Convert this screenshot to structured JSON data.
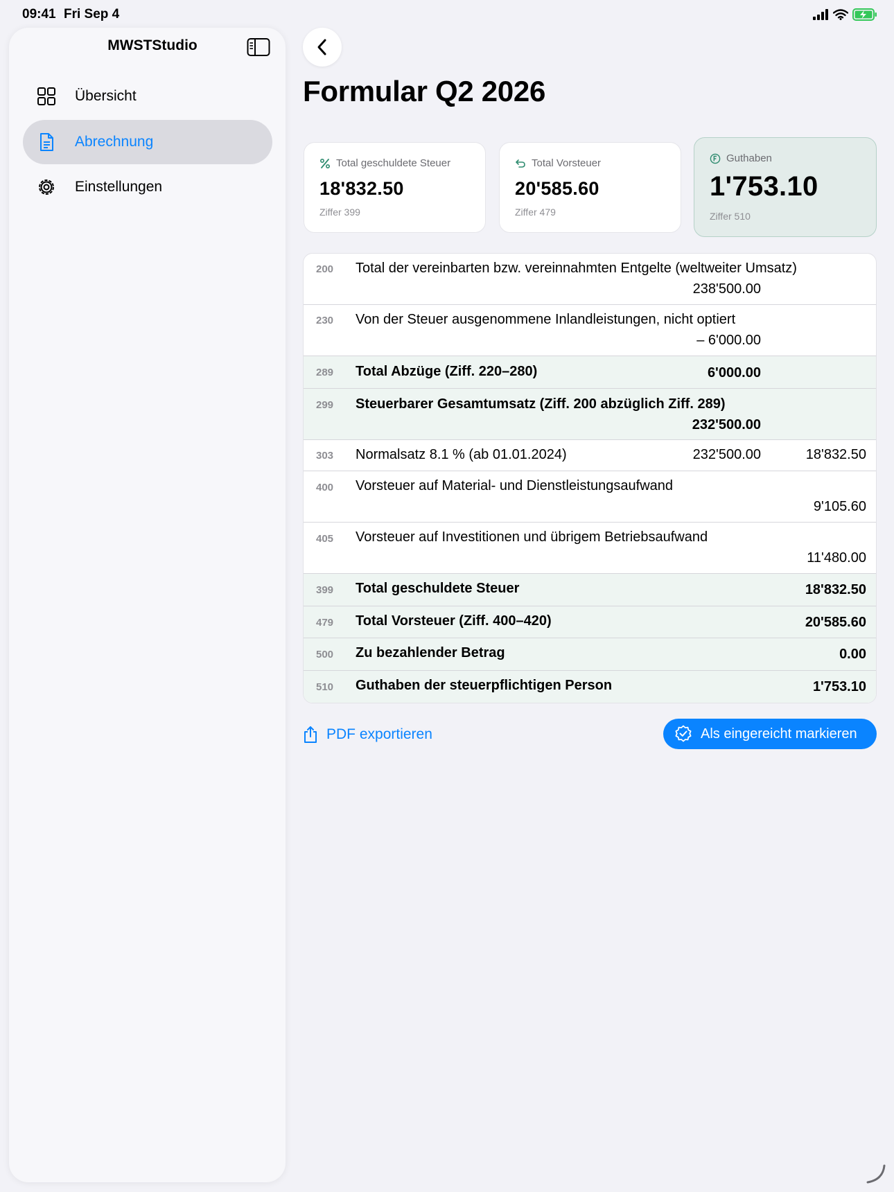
{
  "status_bar": {
    "time": "09:41",
    "date": "Fri Sep 4"
  },
  "sidebar": {
    "title": "MWSTStudio",
    "items": [
      {
        "label": "Übersicht",
        "icon": "grid-icon",
        "active": false
      },
      {
        "label": "Abrechnung",
        "icon": "document-icon",
        "active": true
      },
      {
        "label": "Einstellungen",
        "icon": "gear-icon",
        "active": false
      }
    ]
  },
  "header": {
    "title": "Formular Q2 2026"
  },
  "cards": [
    {
      "label": "Total geschuldete Steuer",
      "value": "18'832.50",
      "sub": "Ziffer 399",
      "icon": "percent-icon"
    },
    {
      "label": "Total Vorsteuer",
      "value": "20'585.60",
      "sub": "Ziffer 479",
      "icon": "return-arrow-icon"
    },
    {
      "label": "Guthaben",
      "value": "1'753.10",
      "sub": "Ziffer 510",
      "icon": "franc-icon"
    }
  ],
  "rows": [
    {
      "code": "200",
      "desc": "Total der vereinbarten bzw. vereinnahmten Entgelte (weltweiter Umsatz)",
      "mid": "238'500.00",
      "right": ""
    },
    {
      "code": "230",
      "desc": "Von der Steuer ausgenommene Inlandleistungen, nicht optiert",
      "mid": "– 6'000.00",
      "right": ""
    },
    {
      "code": "289",
      "desc": "Total Abzüge (Ziff. 220–280)",
      "mid": "6'000.00",
      "right": ""
    },
    {
      "code": "299",
      "desc": "Steuerbarer Gesamtumsatz (Ziff. 200 abzüglich Ziff. 289)",
      "mid": "232'500.00",
      "right": ""
    },
    {
      "code": "303",
      "desc": "Normalsatz 8.1 % (ab 01.01.2024)",
      "mid": "232'500.00",
      "right": "18'832.50"
    },
    {
      "code": "400",
      "desc": "Vorsteuer auf Material- und Dienstleistungsaufwand",
      "mid": "",
      "right": "9'105.60"
    },
    {
      "code": "405",
      "desc": "Vorsteuer auf Investitionen und übrigem Betriebsaufwand",
      "mid": "",
      "right": "11'480.00"
    },
    {
      "code": "399",
      "desc": "Total geschuldete Steuer",
      "mid": "",
      "right": "18'832.50"
    },
    {
      "code": "479",
      "desc": "Total Vorsteuer (Ziff. 400–420)",
      "mid": "",
      "right": "20'585.60"
    },
    {
      "code": "500",
      "desc": "Zu bezahlender Betrag",
      "mid": "",
      "right": "0.00"
    },
    {
      "code": "510",
      "desc": "Guthaben der steuerpflichtigen Person",
      "mid": "",
      "right": "1'753.10"
    }
  ],
  "actions": {
    "export_label": "PDF exportieren",
    "submit_label": "Als eingereicht markieren"
  },
  "colors": {
    "accent": "#0a84ff",
    "highlight_bg": "#e3ecea",
    "total_row_bg": "#eef5f2",
    "icon_green": "#2e8b6f"
  }
}
